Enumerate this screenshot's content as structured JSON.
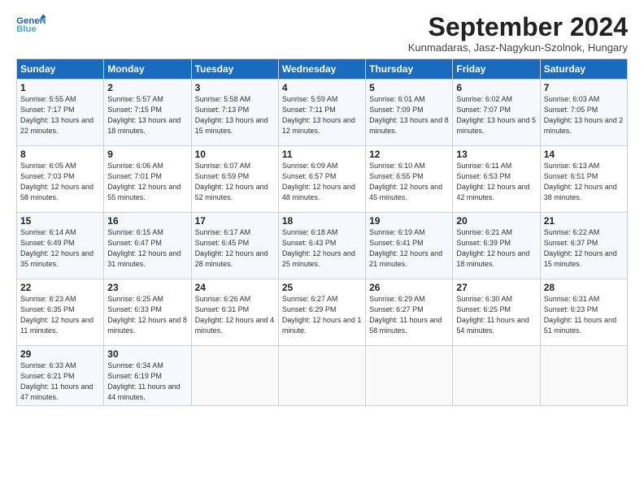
{
  "header": {
    "logo_general": "General",
    "logo_blue": "Blue",
    "title": "September 2024",
    "location": "Kunmadaras, Jasz-Nagykun-Szolnok, Hungary"
  },
  "days_of_week": [
    "Sunday",
    "Monday",
    "Tuesday",
    "Wednesday",
    "Thursday",
    "Friday",
    "Saturday"
  ],
  "weeks": [
    [
      {
        "day": "1",
        "sunrise": "Sunrise: 5:55 AM",
        "sunset": "Sunset: 7:17 PM",
        "daylight": "Daylight: 13 hours and 22 minutes."
      },
      {
        "day": "2",
        "sunrise": "Sunrise: 5:57 AM",
        "sunset": "Sunset: 7:15 PM",
        "daylight": "Daylight: 13 hours and 18 minutes."
      },
      {
        "day": "3",
        "sunrise": "Sunrise: 5:58 AM",
        "sunset": "Sunset: 7:13 PM",
        "daylight": "Daylight: 13 hours and 15 minutes."
      },
      {
        "day": "4",
        "sunrise": "Sunrise: 5:59 AM",
        "sunset": "Sunset: 7:11 PM",
        "daylight": "Daylight: 13 hours and 12 minutes."
      },
      {
        "day": "5",
        "sunrise": "Sunrise: 6:01 AM",
        "sunset": "Sunset: 7:09 PM",
        "daylight": "Daylight: 13 hours and 8 minutes."
      },
      {
        "day": "6",
        "sunrise": "Sunrise: 6:02 AM",
        "sunset": "Sunset: 7:07 PM",
        "daylight": "Daylight: 13 hours and 5 minutes."
      },
      {
        "day": "7",
        "sunrise": "Sunrise: 6:03 AM",
        "sunset": "Sunset: 7:05 PM",
        "daylight": "Daylight: 13 hours and 2 minutes."
      }
    ],
    [
      {
        "day": "8",
        "sunrise": "Sunrise: 6:05 AM",
        "sunset": "Sunset: 7:03 PM",
        "daylight": "Daylight: 12 hours and 58 minutes."
      },
      {
        "day": "9",
        "sunrise": "Sunrise: 6:06 AM",
        "sunset": "Sunset: 7:01 PM",
        "daylight": "Daylight: 12 hours and 55 minutes."
      },
      {
        "day": "10",
        "sunrise": "Sunrise: 6:07 AM",
        "sunset": "Sunset: 6:59 PM",
        "daylight": "Daylight: 12 hours and 52 minutes."
      },
      {
        "day": "11",
        "sunrise": "Sunrise: 6:09 AM",
        "sunset": "Sunset: 6:57 PM",
        "daylight": "Daylight: 12 hours and 48 minutes."
      },
      {
        "day": "12",
        "sunrise": "Sunrise: 6:10 AM",
        "sunset": "Sunset: 6:55 PM",
        "daylight": "Daylight: 12 hours and 45 minutes."
      },
      {
        "day": "13",
        "sunrise": "Sunrise: 6:11 AM",
        "sunset": "Sunset: 6:53 PM",
        "daylight": "Daylight: 12 hours and 42 minutes."
      },
      {
        "day": "14",
        "sunrise": "Sunrise: 6:13 AM",
        "sunset": "Sunset: 6:51 PM",
        "daylight": "Daylight: 12 hours and 38 minutes."
      }
    ],
    [
      {
        "day": "15",
        "sunrise": "Sunrise: 6:14 AM",
        "sunset": "Sunset: 6:49 PM",
        "daylight": "Daylight: 12 hours and 35 minutes."
      },
      {
        "day": "16",
        "sunrise": "Sunrise: 6:15 AM",
        "sunset": "Sunset: 6:47 PM",
        "daylight": "Daylight: 12 hours and 31 minutes."
      },
      {
        "day": "17",
        "sunrise": "Sunrise: 6:17 AM",
        "sunset": "Sunset: 6:45 PM",
        "daylight": "Daylight: 12 hours and 28 minutes."
      },
      {
        "day": "18",
        "sunrise": "Sunrise: 6:18 AM",
        "sunset": "Sunset: 6:43 PM",
        "daylight": "Daylight: 12 hours and 25 minutes."
      },
      {
        "day": "19",
        "sunrise": "Sunrise: 6:19 AM",
        "sunset": "Sunset: 6:41 PM",
        "daylight": "Daylight: 12 hours and 21 minutes."
      },
      {
        "day": "20",
        "sunrise": "Sunrise: 6:21 AM",
        "sunset": "Sunset: 6:39 PM",
        "daylight": "Daylight: 12 hours and 18 minutes."
      },
      {
        "day": "21",
        "sunrise": "Sunrise: 6:22 AM",
        "sunset": "Sunset: 6:37 PM",
        "daylight": "Daylight: 12 hours and 15 minutes."
      }
    ],
    [
      {
        "day": "22",
        "sunrise": "Sunrise: 6:23 AM",
        "sunset": "Sunset: 6:35 PM",
        "daylight": "Daylight: 12 hours and 11 minutes."
      },
      {
        "day": "23",
        "sunrise": "Sunrise: 6:25 AM",
        "sunset": "Sunset: 6:33 PM",
        "daylight": "Daylight: 12 hours and 8 minutes."
      },
      {
        "day": "24",
        "sunrise": "Sunrise: 6:26 AM",
        "sunset": "Sunset: 6:31 PM",
        "daylight": "Daylight: 12 hours and 4 minutes."
      },
      {
        "day": "25",
        "sunrise": "Sunrise: 6:27 AM",
        "sunset": "Sunset: 6:29 PM",
        "daylight": "Daylight: 12 hours and 1 minute."
      },
      {
        "day": "26",
        "sunrise": "Sunrise: 6:29 AM",
        "sunset": "Sunset: 6:27 PM",
        "daylight": "Daylight: 11 hours and 58 minutes."
      },
      {
        "day": "27",
        "sunrise": "Sunrise: 6:30 AM",
        "sunset": "Sunset: 6:25 PM",
        "daylight": "Daylight: 11 hours and 54 minutes."
      },
      {
        "day": "28",
        "sunrise": "Sunrise: 6:31 AM",
        "sunset": "Sunset: 6:23 PM",
        "daylight": "Daylight: 11 hours and 51 minutes."
      }
    ],
    [
      {
        "day": "29",
        "sunrise": "Sunrise: 6:33 AM",
        "sunset": "Sunset: 6:21 PM",
        "daylight": "Daylight: 11 hours and 47 minutes."
      },
      {
        "day": "30",
        "sunrise": "Sunrise: 6:34 AM",
        "sunset": "Sunset: 6:19 PM",
        "daylight": "Daylight: 11 hours and 44 minutes."
      },
      null,
      null,
      null,
      null,
      null
    ]
  ]
}
